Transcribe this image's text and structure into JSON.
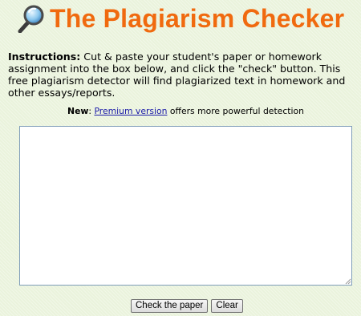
{
  "header": {
    "title": "The Plagiarism Checker",
    "logo_icon": "magnifying-glass-icon"
  },
  "instructions": {
    "lead": "Instructions:",
    "text": " Cut & paste your student's paper or homework assignment into the box below, and click the \"check\" button. This free plagiarism detector will find plagiarized text in homework and other essays/reports."
  },
  "promo": {
    "label": "New",
    "separator": ":",
    "link_text": "Premium version",
    "suffix": "offers more powerful detection"
  },
  "paper_input": {
    "value": ""
  },
  "buttons": {
    "check_label": "Check the paper",
    "clear_label": "Clear"
  },
  "colors": {
    "title": "#f06a0f",
    "background": "#eaf3dc",
    "link": "#1a1aa8",
    "textarea_border": "#7f9db9"
  }
}
